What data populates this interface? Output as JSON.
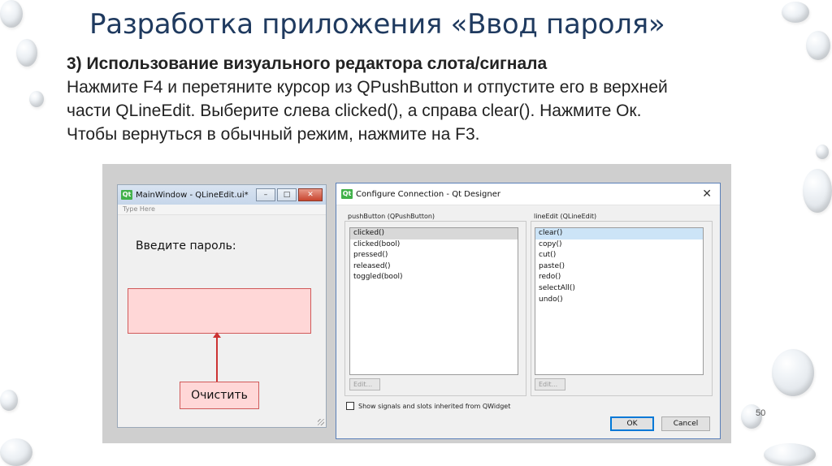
{
  "slide": {
    "title": "Разработка приложения «Ввод пароля»",
    "heading": "3) Использование визуального редактора слота/сигнала",
    "lines": [
      "Нажмите F4 и перетяните курсор из QPushButton и отпустите его в верхней",
      "части QLineEdit.  Выберите слева clicked(), а справа clear(). Нажмите Ок.",
      "Чтобы вернуться в обычный режим, нажмите на F3."
    ],
    "page_number": "50"
  },
  "main_window": {
    "app_icon": "Qt",
    "title": "MainWindow - QLineEdit.ui*",
    "minimize": "–",
    "maximize": "□",
    "close": "✕",
    "menu_placeholder": "Type Here",
    "label": "Введите пароль:",
    "button": "Очистить"
  },
  "dialog": {
    "app_icon": "Qt",
    "title": "Configure Connection - Qt Designer",
    "close": "✕",
    "left_group": "pushButton (QPushButton)",
    "left_items": [
      "clicked()",
      "clicked(bool)",
      "pressed()",
      "released()",
      "toggled(bool)"
    ],
    "right_group": "lineEdit (QLineEdit)",
    "right_items": [
      "clear()",
      "copy()",
      "cut()",
      "paste()",
      "redo()",
      "selectAll()",
      "undo()"
    ],
    "edit_label": "Edit...",
    "checkbox_label": "Show signals and slots inherited from QWidget",
    "ok": "OK",
    "cancel": "Cancel"
  },
  "colors": {
    "title": "#1f3a5f",
    "highlight_widget": "#ffd7d7",
    "connection": "#cc3333"
  }
}
